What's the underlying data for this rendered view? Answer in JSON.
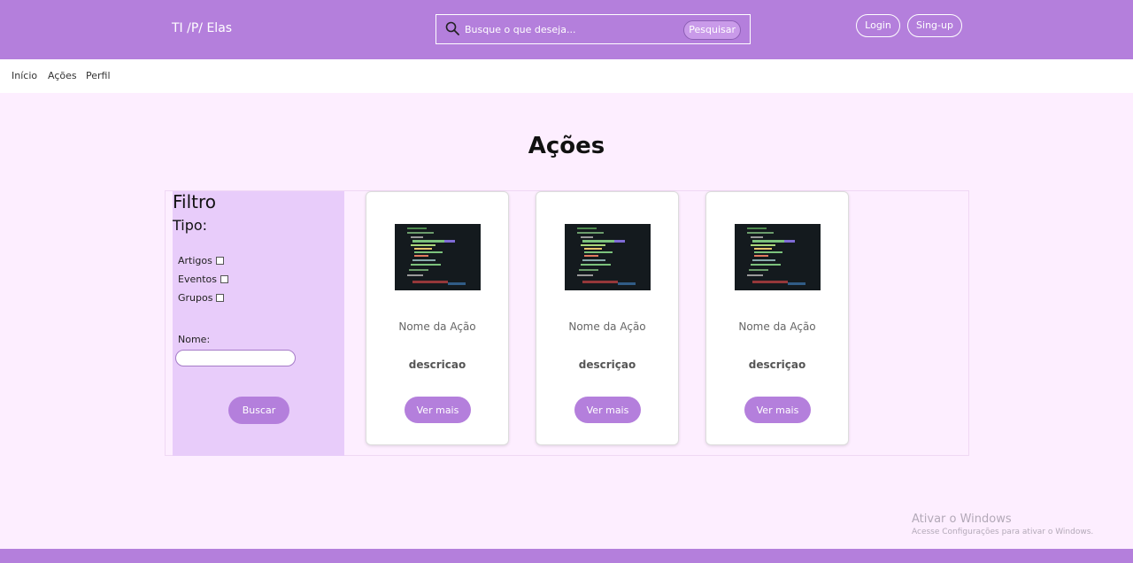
{
  "header": {
    "brand": "TI /P/ Elas",
    "search_placeholder": "Busque o que deseja...",
    "search_button": "Pesquisar",
    "login": "Login",
    "signup": "Sing-up"
  },
  "nav": {
    "items": [
      "Início",
      "Ações",
      "Perfil"
    ]
  },
  "page": {
    "title": "Ações"
  },
  "filter": {
    "title": "Filtro",
    "type_label": "Tipo:",
    "options": [
      "Artigos",
      "Eventos",
      "Grupos"
    ],
    "name_label": "Nome:",
    "search_button": "Buscar"
  },
  "cards": [
    {
      "name": "Nome da Ação",
      "description": "descricao",
      "button": "Ver mais"
    },
    {
      "name": "Nome da Ação",
      "description": "descriçao",
      "button": "Ver mais"
    },
    {
      "name": "Nome da Ação",
      "description": "descriçao",
      "button": "Ver mais"
    }
  ],
  "watermark": {
    "line1": "Ativar o Windows",
    "line2": "Acesse Configurações para ativar o Windows."
  },
  "colors": {
    "primary": "#b47fdc",
    "background": "#fdeeff",
    "filter_panel": "#e8ccfa"
  }
}
